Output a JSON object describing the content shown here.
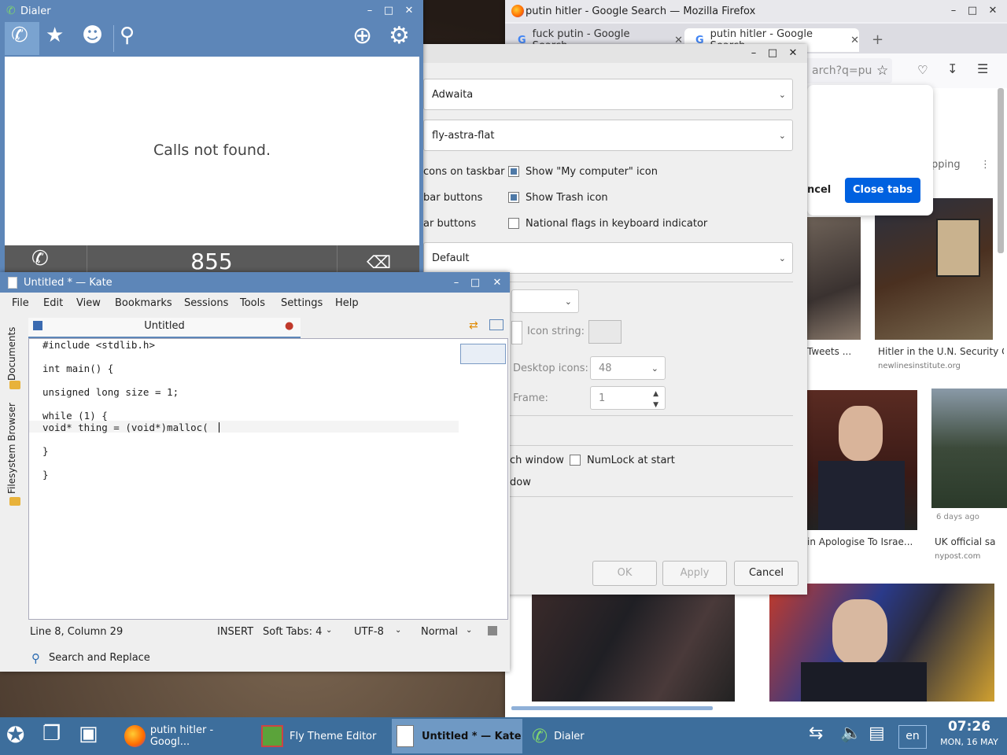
{
  "firefox": {
    "title": "putin hitler - Google Search — Mozilla Firefox",
    "tabs": [
      {
        "label": "fuck putin - Google Search"
      },
      {
        "label": "putin hitler - Google Search"
      }
    ],
    "url_fragment": "arch?q=pu",
    "filter_fragment": "pping",
    "captions": [
      {
        "title": "Tweets ...",
        "source": ""
      },
      {
        "title": "Hitler in the U.N. Security C",
        "source": "newlinesinstitute.org"
      },
      {
        "title": "in Apologise To Israe...",
        "source": ""
      },
      {
        "title": "UK official sa",
        "source": "nypost.com"
      }
    ],
    "time_badge": "6 days ago"
  },
  "close_dialog": {
    "cancel_fragment": "ncel",
    "confirm": "Close tabs"
  },
  "theme_editor": {
    "title": "Fly Theme Editor",
    "combo1": "Adwaita",
    "combo2": "fly-astra-flat",
    "combo3": "Default",
    "left_labels": [
      "cons on taskbar",
      "bar buttons",
      "ar buttons"
    ],
    "checks": [
      {
        "label": "Show \"My computer\" icon",
        "checked": true
      },
      {
        "label": "Show Trash icon",
        "checked": true
      },
      {
        "label": "National flags in keyboard indicator",
        "checked": false
      }
    ],
    "icon_string_label": "Icon string:",
    "desktop_icons_label": "Desktop  icons:",
    "desktop_icons_value": "48",
    "frame_label": "Frame:",
    "frame_value": "1",
    "window_label": "ch window",
    "numlock_label": "NumLock at start",
    "window2_label": "dow",
    "ok": "OK",
    "apply": "Apply",
    "cancel": "Cancel"
  },
  "dialer": {
    "title": "Dialer",
    "empty_message": "Calls not found.",
    "number": "855"
  },
  "kate": {
    "title": "Untitled * — Kate",
    "menu": [
      "File",
      "Edit",
      "View",
      "Bookmarks",
      "Sessions",
      "Tools",
      "Settings",
      "Help"
    ],
    "doc_tab": "Untitled",
    "side_documents": "Documents",
    "side_fs": "Filesystem Browser",
    "code": [
      "#include <stdlib.h>",
      "",
      "int main() {",
      "",
      "unsigned long size = 1;",
      "",
      "while (1) {",
      "void* thing = (void*)malloc(",
      "",
      "}",
      "",
      "}"
    ],
    "status": {
      "position": "Line 8, Column 29",
      "mode": "INSERT",
      "tabs": "Soft Tabs: 4",
      "encoding": "UTF-8",
      "highlight": "Normal",
      "search": "Search and Replace"
    }
  },
  "taskbar": {
    "tasks": [
      {
        "label": "putin hitler - Googl..."
      },
      {
        "label": "Fly Theme Editor"
      },
      {
        "label": "Untitled * — Kate"
      },
      {
        "label": "Dialer"
      }
    ],
    "lang": "en",
    "time": "07:26",
    "date": "MON, 16 MAY"
  }
}
